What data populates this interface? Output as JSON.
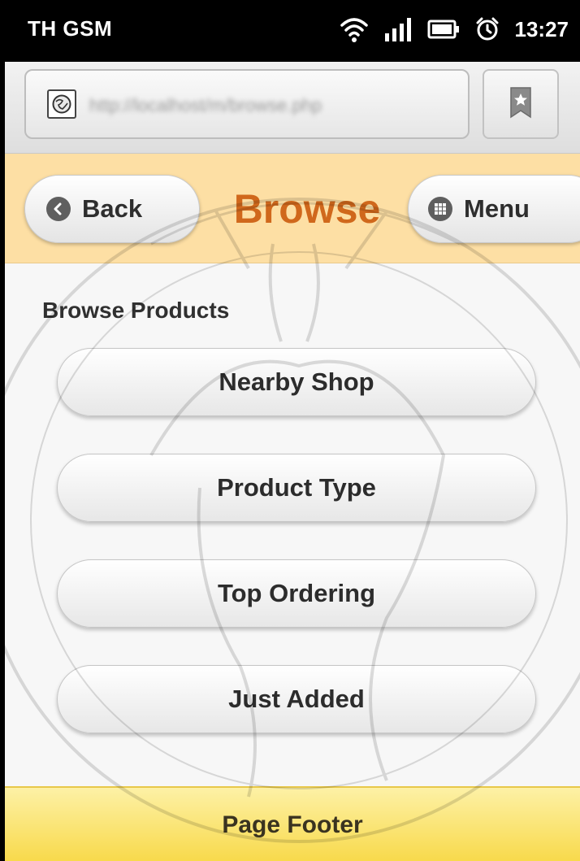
{
  "status_bar": {
    "carrier": "TH GSM",
    "time": "13:27",
    "icons": [
      "wifi-icon",
      "signal-icon",
      "battery-icon",
      "alarm-icon"
    ]
  },
  "browser": {
    "url": "http://localhost/m/browse.php",
    "icons": [
      "globe-icon",
      "bookmark-icon"
    ]
  },
  "header": {
    "title": "Browse",
    "back_label": "Back",
    "menu_label": "Menu"
  },
  "content": {
    "heading": "Browse Products",
    "buttons": [
      {
        "label": "Nearby Shop"
      },
      {
        "label": "Product Type"
      },
      {
        "label": "Top Ordering"
      },
      {
        "label": "Just Added"
      }
    ]
  },
  "footer": {
    "label": "Page Footer"
  },
  "colors": {
    "header_bg": "#fddfa4",
    "title": "#d0681c",
    "footer_bg": "#f8d94a"
  }
}
